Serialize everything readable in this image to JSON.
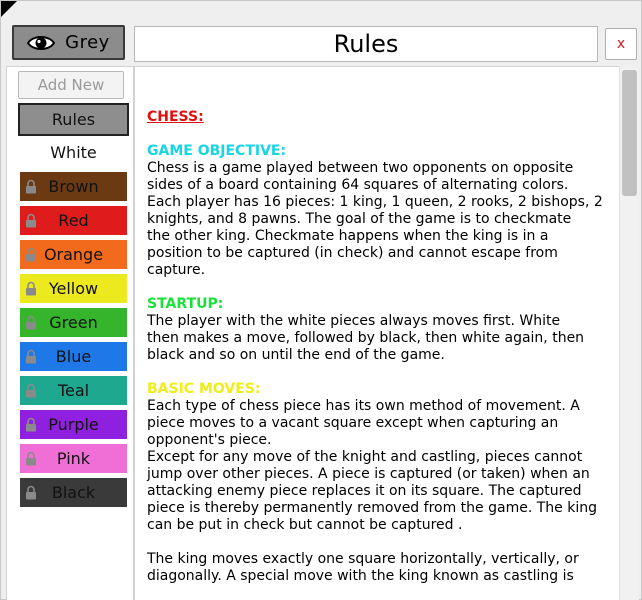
{
  "header": {
    "view_toggle_label": "Grey",
    "title": "Rules",
    "close_label": "x"
  },
  "sidebar": {
    "add_new_label": "Add New",
    "items": [
      {
        "label": "Rules",
        "bg": "#8e8e8e",
        "locked": false,
        "selected": true
      },
      {
        "label": "White",
        "bg": "#ffffff",
        "locked": false,
        "selected": false
      },
      {
        "label": "Brown",
        "bg": "#6b3a12",
        "locked": true,
        "selected": false
      },
      {
        "label": "Red",
        "bg": "#e01b1b",
        "locked": true,
        "selected": false
      },
      {
        "label": "Orange",
        "bg": "#f26a1c",
        "locked": true,
        "selected": false
      },
      {
        "label": "Yellow",
        "bg": "#ece91e",
        "locked": true,
        "selected": false
      },
      {
        "label": "Green",
        "bg": "#34b52b",
        "locked": true,
        "selected": false
      },
      {
        "label": "Blue",
        "bg": "#1f78e8",
        "locked": true,
        "selected": false
      },
      {
        "label": "Teal",
        "bg": "#1fa890",
        "locked": true,
        "selected": false
      },
      {
        "label": "Purple",
        "bg": "#9020e0",
        "locked": true,
        "selected": false
      },
      {
        "label": "Pink",
        "bg": "#f06fd6",
        "locked": true,
        "selected": false
      },
      {
        "label": "Black",
        "bg": "#3a3a3a",
        "locked": true,
        "selected": false
      }
    ]
  },
  "rules": {
    "chess_heading": "CHESS:",
    "sections": [
      {
        "heading": "GAME OBJECTIVE:",
        "color": "#16d5e6",
        "body": "Chess is a game played between two opponents on opposite\nsides of a board containing 64 squares of alternating colors.\nEach player has 16 pieces: 1 king, 1 queen, 2 rooks, 2 bishops, 2\nknights, and 8 pawns. The goal of the game is to checkmate\nthe other king. Checkmate happens when the king is in a\nposition to be captured (in check) and cannot escape from\ncapture."
      },
      {
        "heading": "STARTUP:",
        "color": "#18e23a",
        "body": "The player with the white pieces always moves first. White\nthen makes a move, followed by black, then white again, then\nblack and so on until the end of the game."
      },
      {
        "heading": "BASIC MOVES:",
        "color": "#eeee1a",
        "body": "Each type of chess piece has its own method of movement. A\npiece moves to a vacant square except when capturing an\nopponent's piece.\nExcept for any move of the knight and castling, pieces cannot\njump over other pieces. A piece is captured (or taken) when an\nattacking enemy piece replaces it on its square. The captured\npiece is thereby permanently removed from the game. The king\ncan be put in check but cannot be captured .\n\nThe king moves exactly one square horizontally, vertically, or\ndiagonally. A special move with the king known as castling is"
      }
    ]
  },
  "colors": {
    "chess_heading": "#e01010",
    "selected_border": "#222222",
    "close_x": "#c62020"
  },
  "icons": {
    "view_toggle": "eye-icon",
    "locked_theme": "lock-icon"
  }
}
